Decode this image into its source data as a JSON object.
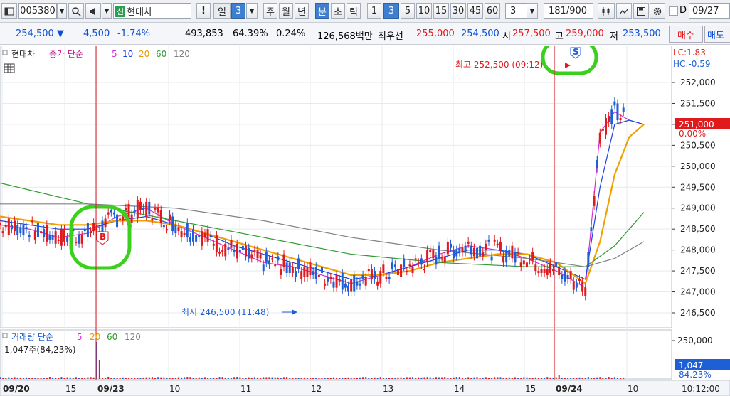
{
  "toolbar": {
    "code": "005380",
    "stock_name": "현대차",
    "credit_badge": "신",
    "alert_label": "!",
    "period_label": "일",
    "period_value": "3",
    "week_label": "주",
    "month_label": "월",
    "year_label": "년",
    "minute_label": "분",
    "second_label": "초",
    "tick_label": "틱",
    "interval_1": "1",
    "interval_3": "3",
    "interval_5": "5",
    "interval_10": "10",
    "interval_15": "15",
    "interval_30": "30",
    "interval_45": "45",
    "interval_60": "60",
    "custom_interval": "3",
    "count_current": "181",
    "count_total": "/900",
    "date_checkbox_label": "D",
    "date_value": "09/27"
  },
  "quote": {
    "price": "254,500",
    "change_arrow": "▼",
    "change": "4,500",
    "change_pct": "-1.74%",
    "volume": "493,853",
    "volume_ratio": "64.39%",
    "turnover_pct": "0.24%",
    "amount": "126,568백만",
    "best_bid_label": "최우선",
    "best_ask": "255,000",
    "best_bid": "254,500",
    "open_label": "시",
    "open": "257,500",
    "high_label": "고",
    "high": "259,000",
    "low_label": "저",
    "low": "253,500",
    "buy_label": "매수",
    "sell_label": "매도"
  },
  "legend": {
    "stock_name": "현대차",
    "indicator": "종가 단순",
    "ma5": "5",
    "ma10": "10",
    "ma20": "20",
    "ma60": "60",
    "ma120": "120"
  },
  "volume_legend": {
    "title": "거래량 단순",
    "ma5": "5",
    "ma20": "20",
    "ma60": "60",
    "ma120": "120",
    "current_volume": "1,047주(84,23%)"
  },
  "annotations": {
    "high_marker": "최고 252,500 (09:12)",
    "low_marker": "최저 246,500 (11:48)",
    "lc": "LC:1.83",
    "hc": "HC:-0.59",
    "current_price_tag": "251,000",
    "current_change_tag": "0.00%",
    "volume_tag": "1,047",
    "volume_pct_tag": "84.23%",
    "buy_signal": "B",
    "sell_signal": "S"
  },
  "colors": {
    "up": "#e0191d",
    "down": "#1f5fd6",
    "ma5": "#d62fd0",
    "ma10": "#1a3fe0",
    "ma20": "#f0a000",
    "ma60": "#2f9a2f",
    "ma120": "#808080",
    "highlight": "#3bd01e"
  },
  "chart_data": {
    "type": "candlestick",
    "price_axis": {
      "ticks": [
        "252,000",
        "251,500",
        "251,000",
        "250,500",
        "250,000",
        "249,500",
        "249,000",
        "248,500",
        "248,000",
        "247,500",
        "247,000",
        "246,500"
      ],
      "range": [
        246300,
        252800
      ]
    },
    "volume_axis": {
      "ticks": [
        "250,000"
      ]
    },
    "time_axis": {
      "ticks": [
        "09/20",
        "15",
        "09/23",
        "10",
        "11",
        "12",
        "13",
        "14",
        "15",
        "09/24",
        "10",
        "10:12:00"
      ]
    },
    "ma_periods": [
      5,
      10,
      20,
      60,
      120
    ],
    "series": [
      {
        "name": "5",
        "segments": [
          [
            0,
            248600
          ],
          [
            10,
            248500
          ],
          [
            20,
            248300
          ],
          [
            30,
            248400
          ],
          [
            40,
            248800
          ],
          [
            50,
            249000
          ],
          [
            60,
            248600
          ],
          [
            70,
            248300
          ],
          [
            80,
            248000
          ],
          [
            90,
            247700
          ],
          [
            100,
            247600
          ],
          [
            110,
            247400
          ],
          [
            120,
            247200
          ],
          [
            130,
            247400
          ],
          [
            140,
            247600
          ],
          [
            150,
            247900
          ],
          [
            160,
            248100
          ],
          [
            170,
            248000
          ],
          [
            180,
            247800
          ],
          [
            190,
            247500
          ],
          [
            200,
            247100
          ],
          [
            205,
            250800
          ],
          [
            210,
            251300
          ],
          [
            215,
            251100
          ],
          [
            220,
            251000
          ]
        ]
      },
      {
        "name": "10",
        "segments": [
          [
            0,
            248700
          ],
          [
            10,
            248600
          ],
          [
            20,
            248500
          ],
          [
            30,
            248500
          ],
          [
            40,
            248700
          ],
          [
            50,
            248800
          ],
          [
            60,
            248600
          ],
          [
            70,
            248400
          ],
          [
            80,
            248100
          ],
          [
            90,
            247900
          ],
          [
            100,
            247700
          ],
          [
            110,
            247500
          ],
          [
            120,
            247300
          ],
          [
            130,
            247400
          ],
          [
            140,
            247600
          ],
          [
            150,
            247800
          ],
          [
            160,
            248000
          ],
          [
            170,
            248000
          ],
          [
            180,
            247900
          ],
          [
            190,
            247600
          ],
          [
            200,
            247300
          ],
          [
            205,
            249500
          ],
          [
            210,
            251000
          ],
          [
            215,
            251100
          ],
          [
            220,
            251000
          ]
        ]
      },
      {
        "name": "20",
        "segments": [
          [
            0,
            248800
          ],
          [
            10,
            248700
          ],
          [
            20,
            248600
          ],
          [
            30,
            248600
          ],
          [
            40,
            248700
          ],
          [
            50,
            248700
          ],
          [
            60,
            248600
          ],
          [
            70,
            248400
          ],
          [
            80,
            248200
          ],
          [
            90,
            248000
          ],
          [
            100,
            247800
          ],
          [
            110,
            247600
          ],
          [
            120,
            247400
          ],
          [
            130,
            247400
          ],
          [
            140,
            247500
          ],
          [
            150,
            247700
          ],
          [
            160,
            247800
          ],
          [
            170,
            247900
          ],
          [
            180,
            247900
          ],
          [
            190,
            247700
          ],
          [
            200,
            247200
          ],
          [
            205,
            248200
          ],
          [
            210,
            249800
          ],
          [
            215,
            250700
          ],
          [
            220,
            251000
          ]
        ]
      },
      {
        "name": "60",
        "segments": [
          [
            0,
            249600
          ],
          [
            30,
            249100
          ],
          [
            60,
            248700
          ],
          [
            90,
            248300
          ],
          [
            120,
            247900
          ],
          [
            150,
            247700
          ],
          [
            180,
            247600
          ],
          [
            200,
            247600
          ],
          [
            210,
            248100
          ],
          [
            220,
            248900
          ]
        ]
      },
      {
        "name": "120",
        "segments": [
          [
            0,
            249100
          ],
          [
            30,
            249100
          ],
          [
            60,
            249000
          ],
          [
            90,
            248700
          ],
          [
            120,
            248300
          ],
          [
            150,
            248000
          ],
          [
            180,
            247800
          ],
          [
            200,
            247600
          ],
          [
            210,
            247800
          ],
          [
            220,
            248200
          ]
        ]
      }
    ]
  }
}
